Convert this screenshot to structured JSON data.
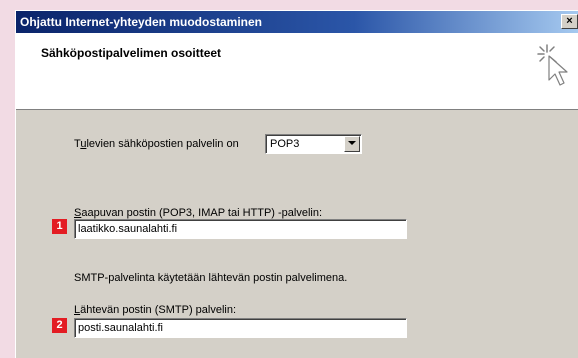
{
  "window": {
    "title": "Ohjattu Internet-yhteyden muodostaminen",
    "close_glyph": "×"
  },
  "header": {
    "title": "Sähköpostipalvelimen osoitteet",
    "icon": "wizard-cursor-icon"
  },
  "form": {
    "incoming_type": {
      "label_accel": "u",
      "label_prefix": "T",
      "label_rest": "levien sähköpostien palvelin on",
      "selected": "POP3"
    },
    "incoming_server": {
      "marker": "1",
      "label_prefix": "",
      "label_accel": "S",
      "label_rest": "aapuvan postin (POP3, IMAP tai HTTP) -palvelin:",
      "value": "laatikko.saunalahti.fi"
    },
    "smtp_note": "SMTP-palvelinta käytetään lähtevän postin palvelimena.",
    "outgoing_server": {
      "marker": "2",
      "label_prefix": "",
      "label_accel": "L",
      "label_rest": "ähtevän postin (SMTP) palvelin:",
      "value": "posti.saunalahti.fi"
    }
  },
  "colors": {
    "dialog_bg": "#d4d0c8",
    "marker_red": "#e31c23",
    "title_blue": "#0a246a",
    "page_bg": "#f2dbe4"
  }
}
